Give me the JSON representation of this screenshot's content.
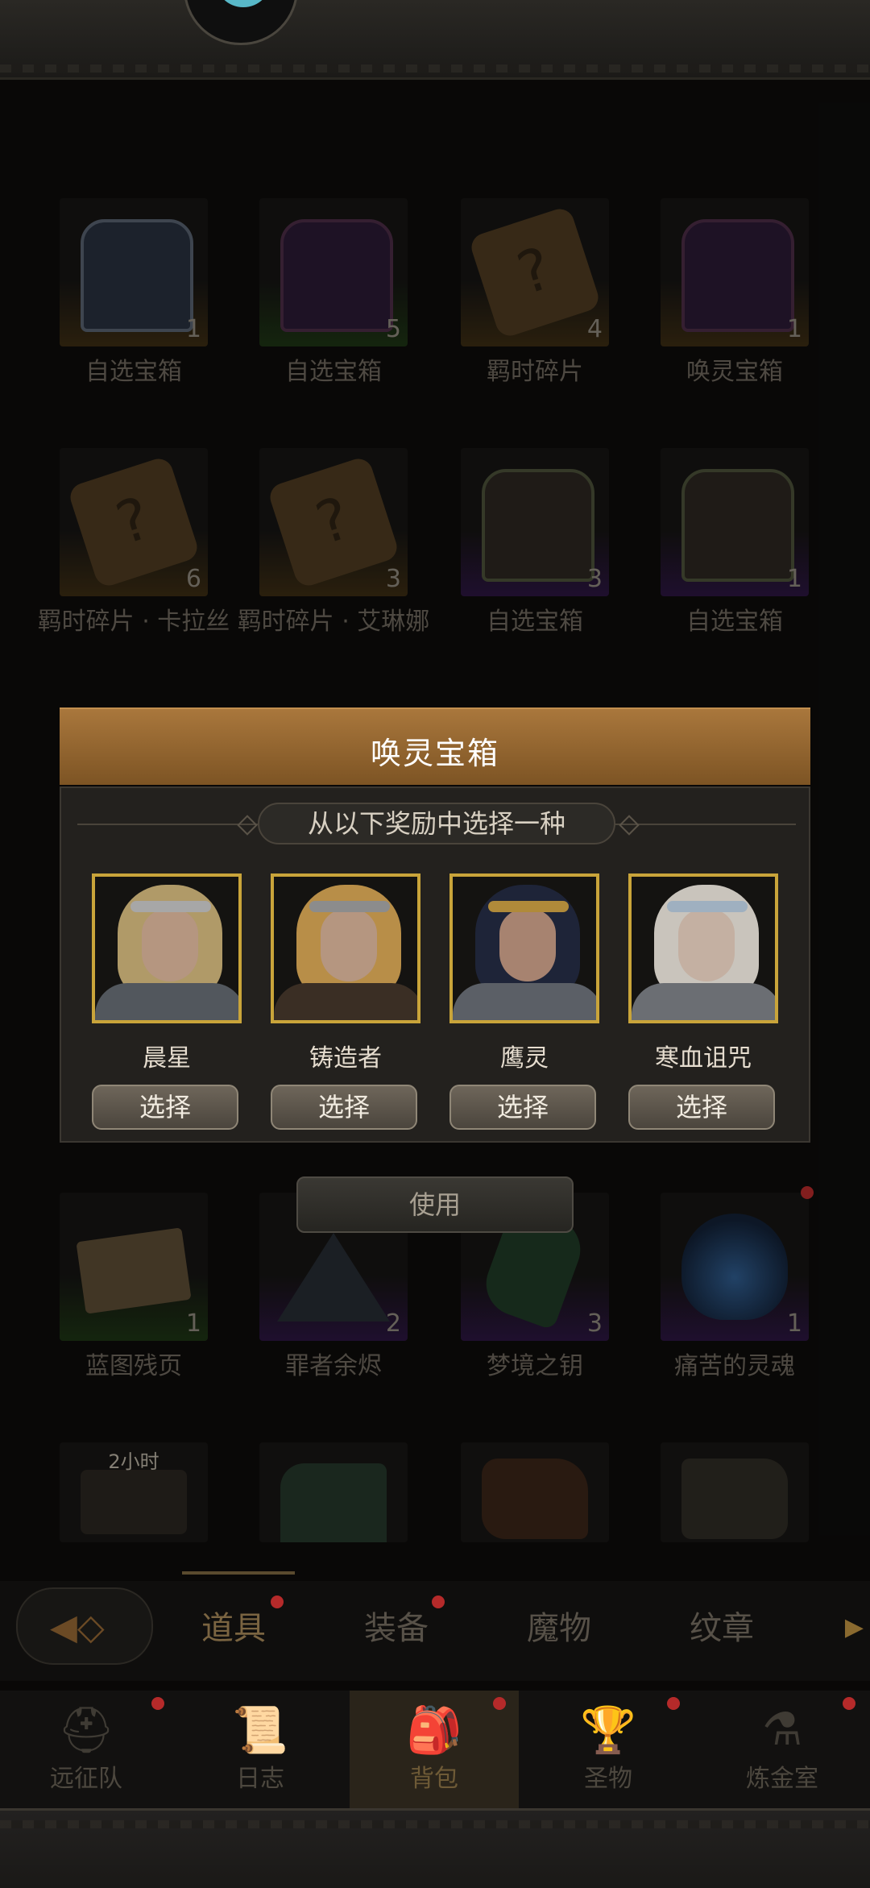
{
  "background_items": {
    "row1": [
      {
        "label": "自选宝箱",
        "count": "1"
      },
      {
        "label": "自选宝箱",
        "count": "5"
      },
      {
        "label": "羁时碎片",
        "count": "4"
      },
      {
        "label": "唤灵宝箱",
        "count": "1"
      }
    ],
    "row2": [
      {
        "label": "羁时碎片 · 卡拉丝",
        "count": "6"
      },
      {
        "label": "羁时碎片 · 艾琳娜",
        "count": "3"
      },
      {
        "label": "自选宝箱",
        "count": "3"
      },
      {
        "label": "自选宝箱",
        "count": "1"
      }
    ],
    "row3": [
      {
        "label": "蓝图残页",
        "count": "1"
      },
      {
        "label": "罪者余烬",
        "count": "2"
      },
      {
        "label": "梦境之钥",
        "count": "3"
      },
      {
        "label": "痛苦的灵魂",
        "count": "1"
      }
    ],
    "row4_timer": "2小时"
  },
  "modal": {
    "title": "唤灵宝箱",
    "subtitle": "从以下奖励中选择一种",
    "choices": [
      {
        "name": "晨星",
        "button": "选择"
      },
      {
        "name": "铸造者",
        "button": "选择"
      },
      {
        "name": "鹰灵",
        "button": "选择"
      },
      {
        "name": "寒血诅咒",
        "button": "选择"
      }
    ]
  },
  "use_button": "使用",
  "tabs": {
    "items": [
      "道具",
      "装备",
      "魔物",
      "纹章"
    ],
    "active": "道具"
  },
  "bottom_nav": {
    "items": [
      {
        "label": "远征队",
        "icon": "helmet-icon"
      },
      {
        "label": "日志",
        "icon": "scroll-icon"
      },
      {
        "label": "背包",
        "icon": "backpack-icon"
      },
      {
        "label": "圣物",
        "icon": "chalice-icon"
      },
      {
        "label": "炼金室",
        "icon": "alchemy-icon"
      }
    ],
    "active": "背包"
  },
  "colors": {
    "modal_header": "#a9773c",
    "portrait_frame": "#c9a43a",
    "notification_dot": "#b52a2a"
  }
}
